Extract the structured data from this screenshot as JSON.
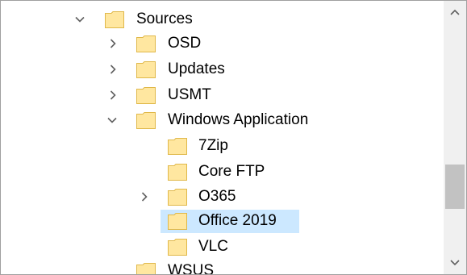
{
  "tree": {
    "items": [
      {
        "label": "Sources",
        "expander": "expanded"
      },
      {
        "label": "OSD",
        "expander": "collapsed"
      },
      {
        "label": "Updates",
        "expander": "collapsed"
      },
      {
        "label": "USMT",
        "expander": "collapsed"
      },
      {
        "label": "Windows Application",
        "expander": "expanded"
      },
      {
        "label": "7Zip",
        "expander": "none"
      },
      {
        "label": "Core FTP",
        "expander": "none"
      },
      {
        "label": "O365",
        "expander": "collapsed"
      },
      {
        "label": "Office 2019",
        "expander": "none",
        "selected": true
      },
      {
        "label": "VLC",
        "expander": "none"
      },
      {
        "label": "WSUS",
        "expander": "none"
      }
    ]
  },
  "colors": {
    "selection": "#cce8ff",
    "folder_fill": "#ffe7a0",
    "folder_stroke": "#e0b84a",
    "chevron": "#606060",
    "scrollbar_track": "#f0f0f0",
    "scrollbar_thumb": "#c2c2c2"
  }
}
